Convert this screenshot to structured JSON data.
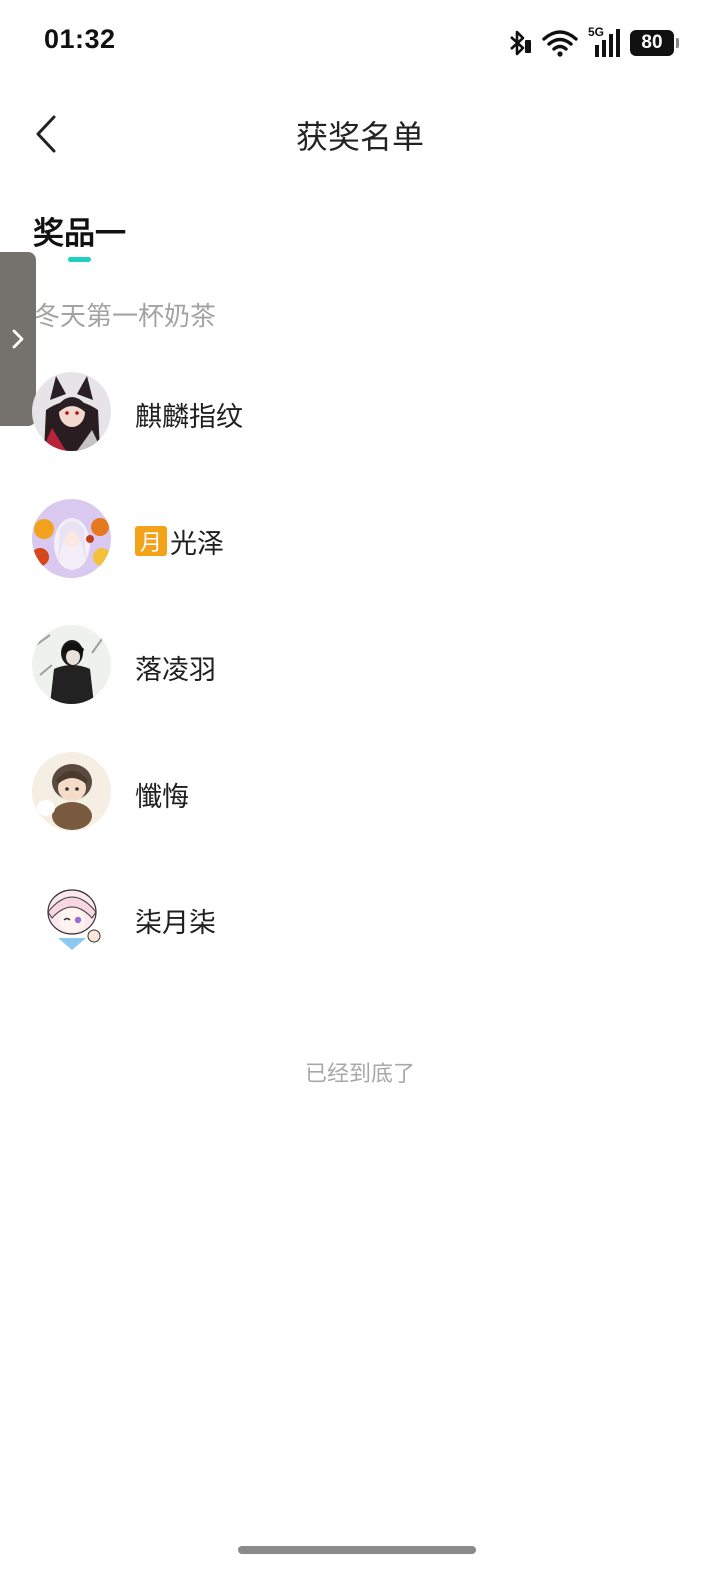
{
  "status_bar": {
    "time": "01:32",
    "network": "5G",
    "battery": "80",
    "icons": [
      "bluetooth-icon",
      "wifi-icon",
      "cellular-signal-icon",
      "battery-icon"
    ]
  },
  "header": {
    "title": "获奖名单",
    "back_icon": "chevron-left-icon"
  },
  "tab": {
    "label": "奖品一",
    "accent_color": "#1fcfc0"
  },
  "side_handle": {
    "icon": "chevron-right-icon",
    "color": "#75716c"
  },
  "prize": {
    "name": "冬天第一杯奶茶"
  },
  "winners": [
    {
      "name": "麒麟指纹",
      "avatar": "fox-girl-avatar"
    },
    {
      "badge": "月",
      "name": "光泽",
      "avatar": "autumn-girl-avatar"
    },
    {
      "name": "落凌羽",
      "avatar": "dark-figure-avatar"
    },
    {
      "name": "懺悔",
      "avatar": "chibi-boy-avatar"
    },
    {
      "name": "柒月柒",
      "avatar": "pink-hair-girl-avatar"
    }
  ],
  "footer": {
    "end_text": "已经到底了"
  }
}
